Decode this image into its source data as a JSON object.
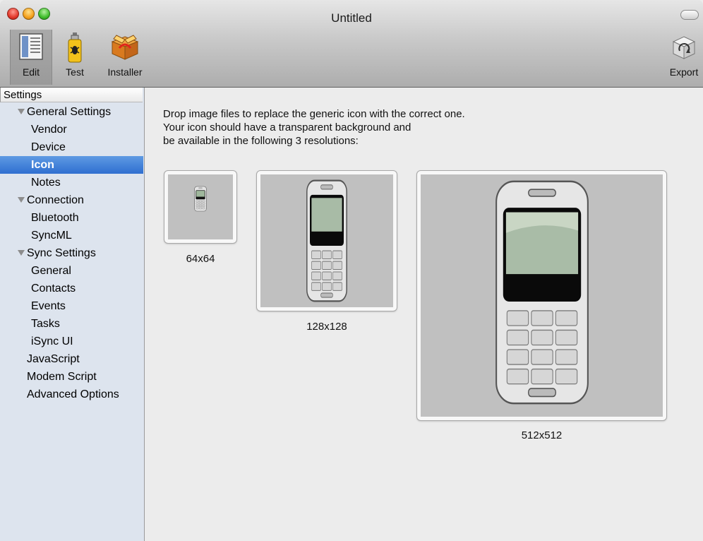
{
  "window": {
    "title": "Untitled"
  },
  "toolbar": {
    "edit_label": "Edit",
    "test_label": "Test",
    "installer_label": "Installer",
    "export_label": "Export"
  },
  "sidebar": {
    "header": "Settings",
    "items": [
      {
        "label": "General Settings",
        "level": 0,
        "disclosure": "expanded"
      },
      {
        "label": "Vendor",
        "level": 1
      },
      {
        "label": "Device",
        "level": 1
      },
      {
        "label": "Icon",
        "level": 1,
        "selected": true
      },
      {
        "label": "Notes",
        "level": 1
      },
      {
        "label": "Connection",
        "level": 0,
        "disclosure": "expanded"
      },
      {
        "label": "Bluetooth",
        "level": 1
      },
      {
        "label": "SyncML",
        "level": 1
      },
      {
        "label": "Sync Settings",
        "level": 0,
        "disclosure": "expanded"
      },
      {
        "label": "General",
        "level": 1
      },
      {
        "label": "Contacts",
        "level": 1
      },
      {
        "label": "Events",
        "level": 1
      },
      {
        "label": "Tasks",
        "level": 1
      },
      {
        "label": "iSync UI",
        "level": 1
      },
      {
        "label": "JavaScript",
        "level": 0
      },
      {
        "label": "Modem Script",
        "level": 0
      },
      {
        "label": "Advanced Options",
        "level": 0
      }
    ]
  },
  "main": {
    "instructions": [
      "Drop image files to replace the generic icon with the correct one.",
      "Your icon should have a transparent background and",
      "be available in the following 3 resolutions:"
    ],
    "wells": [
      {
        "label": "64x64",
        "icon": "phone-icon"
      },
      {
        "label": "128x128",
        "icon": "phone-icon"
      },
      {
        "label": "512x512",
        "icon": "phone-icon"
      }
    ]
  },
  "colors": {
    "selection": "#3d7fd9",
    "sidebar_bg": "#dde4ee",
    "window_bg": "#ececec"
  }
}
